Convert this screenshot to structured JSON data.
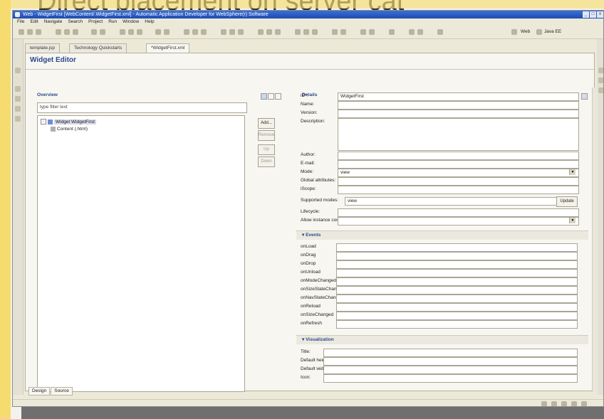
{
  "slide": {
    "title": "Direct placement on server cat"
  },
  "window": {
    "title": "Web - WidgetFirst [WebContent/.WidgetFirst.xml] - Automatic Application Developer for WebSphere(r) Software",
    "controls": [
      "_",
      "□",
      "x"
    ]
  },
  "menubar": [
    "File",
    "Edit",
    "Navigate",
    "Search",
    "Project",
    "Run",
    "Window",
    "Help"
  ],
  "toolbar": {
    "perspectives": [
      "Web",
      "Java EE"
    ]
  },
  "tabs": [
    {
      "label": "template.jsp"
    },
    {
      "label": "Technology Quickstarts"
    },
    {
      "label": "*WidgetFirst.xml"
    }
  ],
  "editor": {
    "title": "Widget Editor",
    "overview": {
      "title": "Overview",
      "filter_placeholder": "type filter text",
      "tree": [
        {
          "label": "Widget WidgetFirst",
          "expand": "-"
        },
        {
          "label": "Content (.html)"
        }
      ],
      "buttons": {
        "add": "Add...",
        "remove": "Remove",
        "up": "Up",
        "down": "Down"
      }
    },
    "details": {
      "title": "Details",
      "fields": [
        {
          "label": "iD*:",
          "value": "WidgetFirst"
        },
        {
          "label": "Name:",
          "value": ""
        },
        {
          "label": "Version:",
          "value": ""
        },
        {
          "label": "Description:",
          "value": ""
        },
        {
          "label": "Author:",
          "value": ""
        },
        {
          "label": "E-mail:",
          "value": ""
        },
        {
          "label": "Mode:",
          "value": "view"
        },
        {
          "label": "Global attributes:",
          "value": ""
        },
        {
          "label": "iScope:",
          "value": ""
        },
        {
          "label": "Supported modes:",
          "value": "view"
        },
        {
          "label": "Lifecycle:",
          "value": ""
        },
        {
          "label": "Allow instance content:",
          "value": ""
        }
      ],
      "update_button": "Update",
      "events": {
        "title": "Events",
        "items": [
          "onLoad",
          "onDrag",
          "onDrop",
          "onUnload",
          "onModeChanged",
          "onSizeStateChanged",
          "onNavStateChanged",
          "onReload",
          "onSizeChanged",
          "onRefresh"
        ]
      },
      "visualization": {
        "title": "Visualization",
        "items": [
          "Title:",
          "Default height:",
          "Default width:",
          "Icon:"
        ]
      }
    }
  },
  "bottom_tabs": [
    "Design",
    "Source"
  ]
}
